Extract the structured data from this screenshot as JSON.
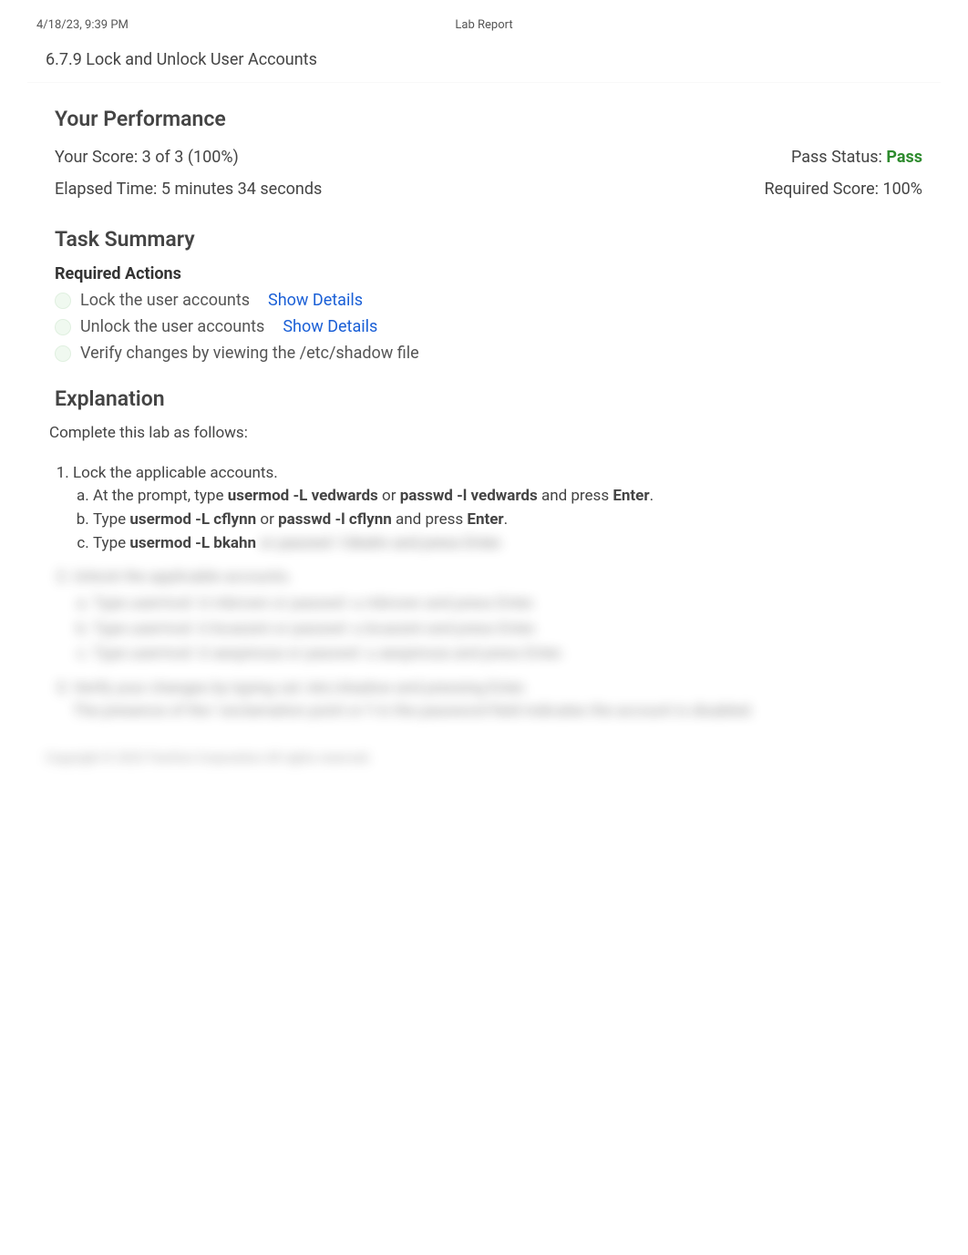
{
  "header": {
    "timestamp": "4/18/23, 9:39 PM",
    "title": "Lab Report"
  },
  "lab": {
    "title": "6.7.9 Lock and Unlock User Accounts"
  },
  "performance": {
    "heading": "Your Performance",
    "score_label": "Your Score: 3 of 3 (100%)",
    "elapsed_label": "Elapsed Time: 5 minutes 34 seconds",
    "pass_label": "Pass Status: ",
    "pass_value": "Pass",
    "required_label": "Required Score: 100%"
  },
  "task_summary": {
    "heading": "Task Summary",
    "required_heading": "Required Actions",
    "actions": [
      {
        "label": "Lock the user accounts",
        "details": "Show Details"
      },
      {
        "label": "Unlock the user accounts",
        "details": "Show Details"
      },
      {
        "label": "Verify changes by viewing the /etc/shadow file",
        "details": ""
      }
    ]
  },
  "explanation": {
    "heading": "Explanation",
    "intro": "Complete this lab as follows:",
    "step1": {
      "title": "Lock the applicable accounts.",
      "a_pre": "At the prompt, type ",
      "a_cmd1": "usermod -L vedwards",
      "a_or": " or ",
      "a_cmd2": "passwd -l vedwards",
      "a_and": " and press ",
      "a_key": "Enter",
      "a_end": ".",
      "b_pre": "Type ",
      "b_cmd1": "usermod -L cflynn",
      "b_or": " or ",
      "b_cmd2": "passwd -l cflynn",
      "b_and": " and press ",
      "b_key": "Enter",
      "b_end": ".",
      "c_pre": "Type ",
      "c_cmd1": "usermod -L bkahn"
    },
    "blurred": {
      "c_rest": " or passwd -l bkahn and press Enter.",
      "step2_title": "Unlock the applicable accounts.",
      "step2_a": "Type usermod -U mbrown or passwd -u mbrown and press Enter.",
      "step2_b": "Type usermod -U bcassini or passwd -u bcassini and press Enter.",
      "step2_c": "Type usermod -U aespinoza or passwd -u aespinoza and press Enter.",
      "step3_title": "Verify your changes by typing cat /etc/shadow and pressing Enter.",
      "step3_detail": "The presence of the ! exclamation point or !! in the password field indicates the account is disabled."
    }
  },
  "footer": {
    "copyright": "Copyright © 2023 TestOut Corporation All rights reserved."
  }
}
